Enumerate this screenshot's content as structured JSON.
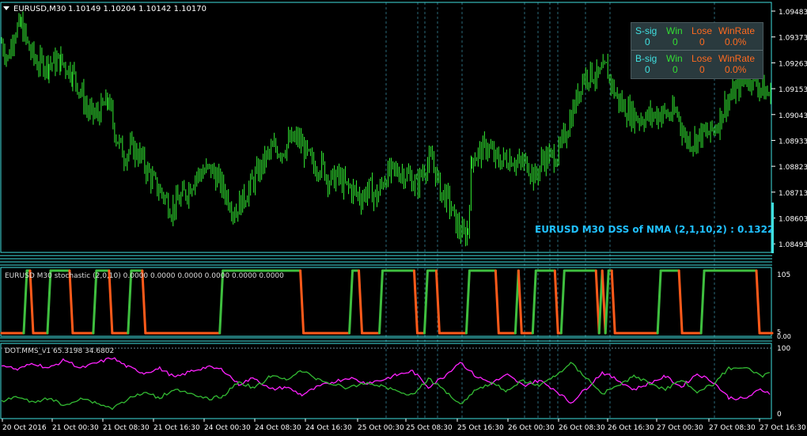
{
  "main": {
    "symbol_label": "EURUSD,M30",
    "ohlc": "1.10149 1.10204 1.10142 1.10170",
    "indicator_label": "EURUSD M30 DSS of NMA (2,1,10,2) : 0.1322",
    "price_ticks": [
      "1.09483",
      "1.09373",
      "1.09263",
      "1.09153",
      "1.09043",
      "1.08933",
      "1.08823",
      "1.08713",
      "1.08603",
      "1.08493"
    ],
    "ylim": [
      1.0846,
      1.0951
    ]
  },
  "signals": {
    "sell_row": {
      "label": "S-sig",
      "win_label": "Win",
      "lose_label": "Lose",
      "rate_label": "WinRate",
      "sig": "0",
      "win": "0",
      "lose": "0",
      "rate": "0.0%"
    },
    "buy_row": {
      "label": "B-sig",
      "win_label": "Win",
      "lose_label": "Lose",
      "rate_label": "WinRate",
      "sig": "0",
      "win": "0",
      "lose": "0",
      "rate": "0.0%"
    }
  },
  "stoch_panel": {
    "label": "EURUSD M30 stochastic (2,0,10) 0.0000 0.0000 0.0000 0.0000 0.0000 0.0000",
    "ticks": [
      "105",
      "5",
      "0.00"
    ]
  },
  "dot_panel": {
    "label": "DOT.MMS_v1 65.3198 34.6802",
    "ticks": [
      "100",
      "0"
    ]
  },
  "time_labels": [
    "20 Oct 2016",
    "21 Oct 00:30",
    "21 Oct 08:30",
    "21 Oct 16:30",
    "24 Oct 00:30",
    "24 Oct 08:30",
    "24 Oct 16:30",
    "25 Oct 00:30",
    "25 Oct 08:30",
    "25 Oct 16:30",
    "26 Oct 00:30",
    "26 Oct 08:30",
    "26 Oct 16:30",
    "27 Oct 00:30",
    "27 Oct 08:30",
    "27 Oct 16:30"
  ],
  "colors": {
    "candle": "#33ee33",
    "axis": "#40e0e0",
    "grid": "#2a6a7a",
    "stoch_up": "#3fbf3f",
    "stoch_down": "#ff5a1a",
    "dot_a": "#ff22ff",
    "dot_b": "#33bb33",
    "label": "#20c0ff"
  },
  "chart_data": [
    {
      "type": "candlestick",
      "title": "EURUSD,M30",
      "ylim": [
        1.0846,
        1.0951
      ],
      "y_ticks": [
        1.09483,
        1.09373,
        1.09263,
        1.09153,
        1.09043,
        1.08933,
        1.08823,
        1.08713,
        1.08603,
        1.08493
      ],
      "close_path": [
        [
          0,
          1.0935
        ],
        [
          8,
          1.0928
        ],
        [
          16,
          1.094
        ],
        [
          25,
          1.0942
        ],
        [
          35,
          1.0932
        ],
        [
          45,
          1.0926
        ],
        [
          60,
          1.0926
        ],
        [
          75,
          1.0927
        ],
        [
          90,
          1.0922
        ],
        [
          100,
          1.0914
        ],
        [
          110,
          1.0905
        ],
        [
          120,
          1.0904
        ],
        [
          135,
          1.091
        ],
        [
          145,
          1.0895
        ],
        [
          155,
          1.0887
        ],
        [
          165,
          1.089
        ],
        [
          175,
          1.0887
        ],
        [
          185,
          1.088
        ],
        [
          195,
          1.0874
        ],
        [
          205,
          1.087
        ],
        [
          215,
          1.0864
        ],
        [
          225,
          1.0868
        ],
        [
          235,
          1.0872
        ],
        [
          245,
          1.0878
        ],
        [
          255,
          1.088
        ],
        [
          265,
          1.0881
        ],
        [
          275,
          1.0876
        ],
        [
          285,
          1.087
        ],
        [
          295,
          1.0863
        ],
        [
          305,
          1.0868
        ],
        [
          315,
          1.0874
        ],
        [
          325,
          1.088
        ],
        [
          335,
          1.0886
        ],
        [
          345,
          1.089
        ],
        [
          355,
          1.0889
        ],
        [
          365,
          1.0893
        ],
        [
          375,
          1.0894
        ],
        [
          385,
          1.0888
        ],
        [
          395,
          1.0882
        ],
        [
          405,
          1.0883
        ],
        [
          415,
          1.0876
        ],
        [
          425,
          1.0878
        ],
        [
          435,
          1.0874
        ],
        [
          445,
          1.0872
        ],
        [
          455,
          1.0869
        ],
        [
          465,
          1.0873
        ],
        [
          475,
          1.0869
        ],
        [
          485,
          1.0878
        ],
        [
          495,
          1.088
        ],
        [
          505,
          1.088
        ],
        [
          515,
          1.0878
        ],
        [
          525,
          1.0874
        ],
        [
          535,
          1.0882
        ],
        [
          545,
          1.0885
        ],
        [
          555,
          1.0872
        ],
        [
          565,
          1.0868
        ],
        [
          575,
          1.0858
        ],
        [
          585,
          1.0852
        ],
        [
          590,
          1.0856
        ],
        [
          595,
          1.0886
        ],
        [
          605,
          1.0888
        ],
        [
          615,
          1.0891
        ],
        [
          625,
          1.0885
        ],
        [
          635,
          1.0885
        ],
        [
          645,
          1.0886
        ],
        [
          655,
          1.0883
        ],
        [
          665,
          1.0884
        ],
        [
          675,
          1.0877
        ],
        [
          685,
          1.0886
        ],
        [
          695,
          1.0886
        ],
        [
          705,
          1.0888
        ],
        [
          715,
          1.0898
        ],
        [
          725,
          1.0908
        ],
        [
          735,
          1.092
        ],
        [
          745,
          1.0922
        ],
        [
          755,
          1.092
        ],
        [
          765,
          1.0924
        ],
        [
          775,
          1.0914
        ],
        [
          785,
          1.0908
        ],
        [
          795,
          1.0905
        ],
        [
          805,
          1.0903
        ],
        [
          815,
          1.0903
        ],
        [
          825,
          1.0904
        ],
        [
          835,
          1.0905
        ],
        [
          845,
          1.0904
        ],
        [
          855,
          1.0905
        ],
        [
          865,
          1.0894
        ],
        [
          875,
          1.0893
        ],
        [
          885,
          1.0896
        ],
        [
          895,
          1.0896
        ],
        [
          905,
          1.09
        ],
        [
          915,
          1.0908
        ],
        [
          925,
          1.0913
        ],
        [
          935,
          1.0918
        ],
        [
          945,
          1.0921
        ],
        [
          955,
          1.0918
        ],
        [
          965,
          1.0914
        ],
        [
          975,
          1.0912
        ]
      ]
    },
    {
      "type": "line",
      "title": "EURUSD M30 stochastic (2,0,10)",
      "ylim": [
        0,
        105
      ],
      "series": [
        {
          "name": "stochastic",
          "values": [
            [
              0,
              0
            ],
            [
              28,
              0
            ],
            [
              32,
              100
            ],
            [
              36,
              100
            ],
            [
              40,
              0
            ],
            [
              58,
              0
            ],
            [
              62,
              100
            ],
            [
              86,
              100
            ],
            [
              90,
              0
            ],
            [
              116,
              0
            ],
            [
              120,
              100
            ],
            [
              136,
              100
            ],
            [
              140,
              0
            ],
            [
              160,
              0
            ],
            [
              164,
              100
            ],
            [
              178,
              100
            ],
            [
              182,
              0
            ],
            [
              276,
              0
            ],
            [
              280,
              100
            ],
            [
              378,
              100
            ],
            [
              382,
              0
            ],
            [
              440,
              0
            ],
            [
              444,
              100
            ],
            [
              452,
              100
            ],
            [
              456,
              0
            ],
            [
              478,
              0
            ],
            [
              482,
              100
            ],
            [
              522,
              100
            ],
            [
              526,
              0
            ],
            [
              535,
              0
            ],
            [
              539,
              100
            ],
            [
              550,
              100
            ],
            [
              554,
              0
            ],
            [
              588,
              0
            ],
            [
              592,
              100
            ],
            [
              625,
              100
            ],
            [
              629,
              0
            ],
            [
              650,
              0
            ],
            [
              654,
              100
            ],
            [
              658,
              0
            ],
            [
              672,
              0
            ],
            [
              676,
              100
            ],
            [
              700,
              100
            ],
            [
              704,
              0
            ],
            [
              708,
              0
            ],
            [
              712,
              100
            ],
            [
              752,
              100
            ],
            [
              756,
              0
            ],
            [
              760,
              100
            ],
            [
              764,
              0
            ],
            [
              768,
              100
            ],
            [
              772,
              100
            ],
            [
              776,
              0
            ],
            [
              780,
              0
            ],
            [
              784,
              0
            ],
            [
              830,
              0
            ],
            [
              834,
              100
            ],
            [
              857,
              100
            ],
            [
              861,
              0
            ],
            [
              885,
              0
            ],
            [
              889,
              100
            ],
            [
              955,
              100
            ],
            [
              959,
              0
            ],
            [
              975,
              0
            ]
          ]
        }
      ]
    },
    {
      "type": "line",
      "title": "DOT.MMS_v1",
      "ylim": [
        0,
        100
      ],
      "series": [
        {
          "name": "DOT.MMS_v1 65.3198",
          "values": [
            [
              0,
              78
            ],
            [
              20,
              70
            ],
            [
              40,
              80
            ],
            [
              60,
              72
            ],
            [
              80,
              85
            ],
            [
              100,
              72
            ],
            [
              120,
              80
            ],
            [
              140,
              88
            ],
            [
              160,
              74
            ],
            [
              180,
              65
            ],
            [
              200,
              72
            ],
            [
              220,
              58
            ],
            [
              240,
              68
            ],
            [
              260,
              74
            ],
            [
              280,
              70
            ],
            [
              300,
              48
            ],
            [
              320,
              58
            ],
            [
              340,
              40
            ],
            [
              360,
              44
            ],
            [
              380,
              32
            ],
            [
              400,
              44
            ],
            [
              420,
              52
            ],
            [
              440,
              58
            ],
            [
              460,
              50
            ],
            [
              480,
              54
            ],
            [
              500,
              62
            ],
            [
              520,
              68
            ],
            [
              540,
              44
            ],
            [
              560,
              60
            ],
            [
              580,
              82
            ],
            [
              600,
              60
            ],
            [
              620,
              50
            ],
            [
              640,
              62
            ],
            [
              660,
              46
            ],
            [
              680,
              54
            ],
            [
              700,
              40
            ],
            [
              720,
              20
            ],
            [
              740,
              42
            ],
            [
              760,
              66
            ],
            [
              780,
              54
            ],
            [
              800,
              40
            ],
            [
              820,
              50
            ],
            [
              840,
              60
            ],
            [
              860,
              44
            ],
            [
              880,
              64
            ],
            [
              900,
              52
            ],
            [
              920,
              28
            ],
            [
              940,
              26
            ],
            [
              960,
              40
            ],
            [
              975,
              34
            ]
          ]
        },
        {
          "name": "DOT.MMS_v1 34.6802",
          "values": [
            [
              0,
              22
            ],
            [
              20,
              30
            ],
            [
              40,
              20
            ],
            [
              60,
              28
            ],
            [
              80,
              15
            ],
            [
              100,
              28
            ],
            [
              120,
              20
            ],
            [
              140,
              12
            ],
            [
              160,
              26
            ],
            [
              180,
              35
            ],
            [
              200,
              28
            ],
            [
              220,
              42
            ],
            [
              240,
              32
            ],
            [
              260,
              26
            ],
            [
              280,
              30
            ],
            [
              300,
              52
            ],
            [
              320,
              42
            ],
            [
              340,
              60
            ],
            [
              360,
              56
            ],
            [
              380,
              68
            ],
            [
              400,
              56
            ],
            [
              420,
              48
            ],
            [
              440,
              42
            ],
            [
              460,
              50
            ],
            [
              480,
              46
            ],
            [
              500,
              38
            ],
            [
              520,
              32
            ],
            [
              540,
              56
            ],
            [
              560,
              40
            ],
            [
              580,
              18
            ],
            [
              600,
              40
            ],
            [
              620,
              50
            ],
            [
              640,
              38
            ],
            [
              660,
              54
            ],
            [
              680,
              46
            ],
            [
              700,
              60
            ],
            [
              720,
              80
            ],
            [
              740,
              58
            ],
            [
              760,
              34
            ],
            [
              780,
              46
            ],
            [
              800,
              60
            ],
            [
              820,
              50
            ],
            [
              840,
              40
            ],
            [
              860,
              56
            ],
            [
              880,
              36
            ],
            [
              900,
              48
            ],
            [
              920,
              72
            ],
            [
              940,
              74
            ],
            [
              960,
              60
            ],
            [
              975,
              66
            ]
          ]
        }
      ]
    }
  ]
}
